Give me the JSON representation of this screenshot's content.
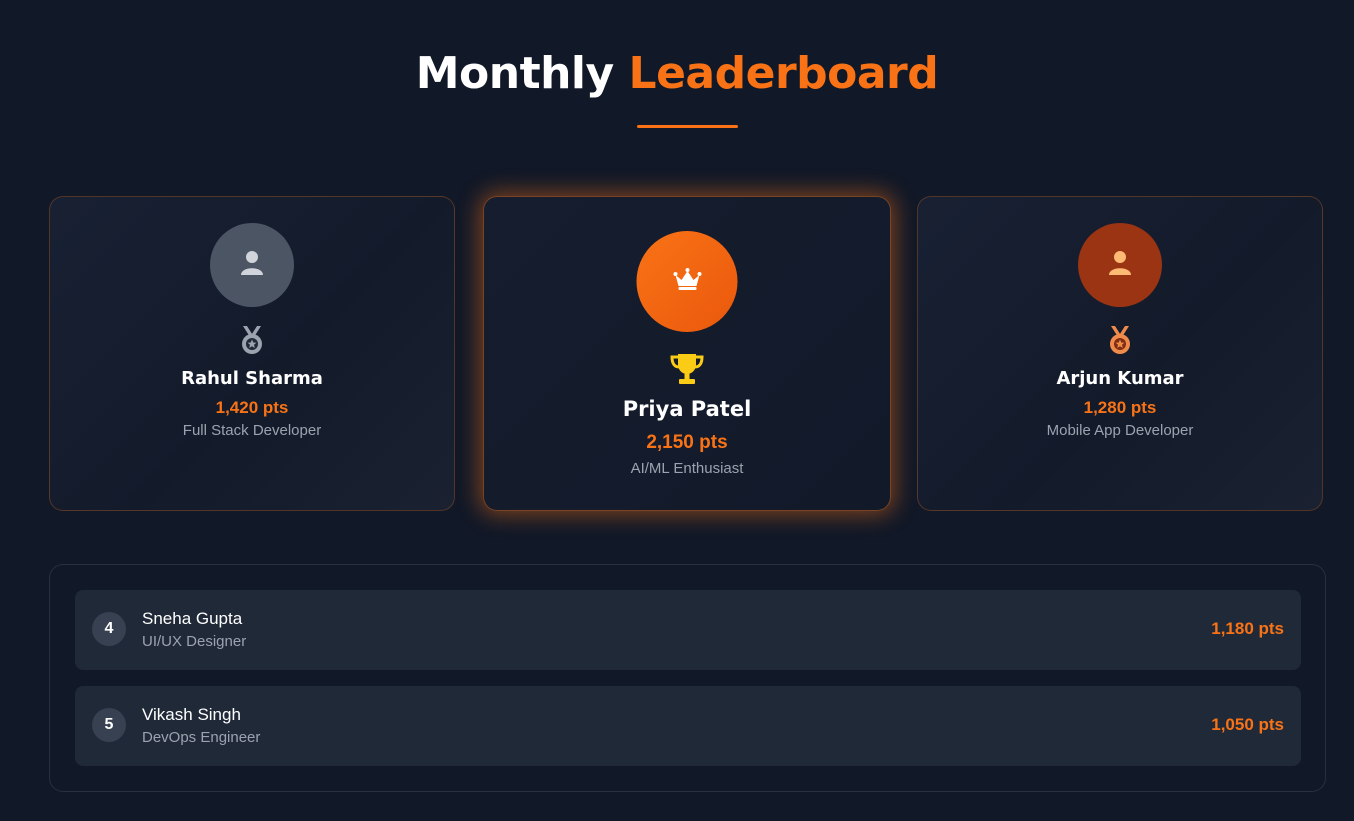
{
  "header": {
    "title_part1": "Monthly",
    "title_part2": "Leaderboard"
  },
  "podium": {
    "first": {
      "name": "Priya Patel",
      "points": "2,150 pts",
      "role": "AI/ML Enthusiast",
      "avatar_icon": "crown-icon",
      "medal_icon": "trophy-icon"
    },
    "second": {
      "name": "Rahul Sharma",
      "points": "1,420 pts",
      "role": "Full Stack Developer",
      "avatar_icon": "user-icon",
      "medal_icon": "silver-medal-icon"
    },
    "third": {
      "name": "Arjun Kumar",
      "points": "1,280 pts",
      "role": "Mobile App Developer",
      "avatar_icon": "user-icon",
      "medal_icon": "bronze-medal-icon"
    }
  },
  "rankings": [
    {
      "rank": "4",
      "name": "Sneha Gupta",
      "role": "UI/UX Designer",
      "points": "1,180 pts"
    },
    {
      "rank": "5",
      "name": "Vikash Singh",
      "role": "DevOps Engineer",
      "points": "1,050 pts"
    }
  ],
  "colors": {
    "accent": "#f97316",
    "background": "#111827",
    "silver": "#9ca3af",
    "bronze": "#f08a4b",
    "gold": "#facc15"
  }
}
